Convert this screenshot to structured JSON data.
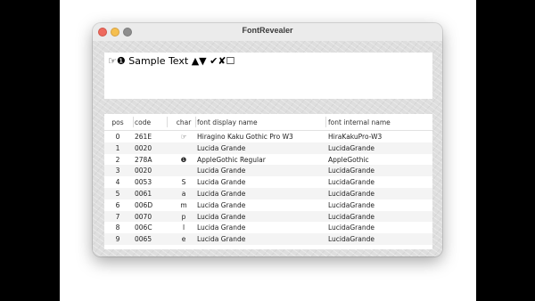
{
  "window": {
    "title": "FontRevealer"
  },
  "sample": {
    "text": "☞❶ Sample Text ▲▼ ✔✘☐"
  },
  "table": {
    "headers": {
      "pos": "pos",
      "code": "code",
      "char": "char",
      "display": "font display name",
      "internal": "font internal name"
    },
    "rows": [
      {
        "pos": "0",
        "code": "261E",
        "char": "☞",
        "display": "Hiragino Kaku Gothic Pro W3",
        "internal": "HiraKakuPro-W3"
      },
      {
        "pos": "1",
        "code": "0020",
        "char": " ",
        "display": "Lucida Grande",
        "internal": "LucidaGrande"
      },
      {
        "pos": "2",
        "code": "278A",
        "char": "❶",
        "display": "AppleGothic Regular",
        "internal": "AppleGothic"
      },
      {
        "pos": "3",
        "code": "0020",
        "char": " ",
        "display": "Lucida Grande",
        "internal": "LucidaGrande"
      },
      {
        "pos": "4",
        "code": "0053",
        "char": "S",
        "display": "Lucida Grande",
        "internal": "LucidaGrande"
      },
      {
        "pos": "5",
        "code": "0061",
        "char": "a",
        "display": "Lucida Grande",
        "internal": "LucidaGrande"
      },
      {
        "pos": "6",
        "code": "006D",
        "char": "m",
        "display": "Lucida Grande",
        "internal": "LucidaGrande"
      },
      {
        "pos": "7",
        "code": "0070",
        "char": "p",
        "display": "Lucida Grande",
        "internal": "LucidaGrande"
      },
      {
        "pos": "8",
        "code": "006C",
        "char": "l",
        "display": "Lucida Grande",
        "internal": "LucidaGrande"
      },
      {
        "pos": "9",
        "code": "0065",
        "char": "e",
        "display": "Lucida Grande",
        "internal": "LucidaGrande"
      }
    ]
  }
}
